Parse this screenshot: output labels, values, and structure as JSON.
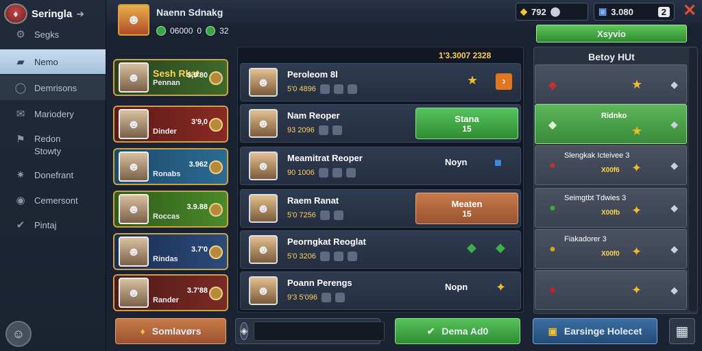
{
  "app": {
    "title": "Seringla"
  },
  "sidebar": {
    "items": [
      {
        "label": "Segks",
        "icon": "gear-icon"
      },
      {
        "label": "Nemo",
        "icon": "inbox-icon"
      },
      {
        "label": "Demrisons",
        "icon": "user-icon"
      },
      {
        "label": "Mariodery",
        "icon": "envelope-icon"
      },
      {
        "label": "Redon Stowty",
        "icon": "flag-icon"
      },
      {
        "label": "Donefrant",
        "icon": "settings-icon"
      },
      {
        "label": "Cemersont",
        "icon": "target-icon"
      },
      {
        "label": "Pintaj",
        "icon": "mail-icon"
      }
    ]
  },
  "profile": {
    "name": "Naenn Sdnakg",
    "coins": "06000",
    "zero": "0",
    "gems": "32"
  },
  "currency": {
    "gold": "792",
    "tickets": "3.080",
    "lives": "2"
  },
  "heroes": [
    {
      "title": "Sesh Rkat",
      "subtitle": "Pennan",
      "score": "3,9'80",
      "bg": "#3e6a2a"
    },
    {
      "title": "",
      "subtitle": "Dinder",
      "score": "3'9,0",
      "bg": "#8a2a24"
    },
    {
      "title": "",
      "subtitle": "Ronabs",
      "score": "3.962",
      "bg": "#2c6a92"
    },
    {
      "title": "",
      "subtitle": "Roccas",
      "score": "3.9.88",
      "bg": "#4a8a2a"
    },
    {
      "title": "",
      "subtitle": "Rindas",
      "score": "3.7'0",
      "bg": "#2c4a7a"
    },
    {
      "title": "",
      "subtitle": "Rander",
      "score": "3.7'88",
      "bg": "#7a2a24"
    }
  ],
  "main": {
    "header": "1'3.3007  2328",
    "rows": [
      {
        "name": "Peroleom 8l",
        "stat": "5'0 4896",
        "action": "",
        "sub": ""
      },
      {
        "name": "Nam Reoper",
        "stat": "93 2096",
        "action": "Stana",
        "sub": "15"
      },
      {
        "name": "Meamitrat Reoper",
        "stat": "90 1006",
        "action": "Noyn",
        "sub": ""
      },
      {
        "name": "Raem Ranat",
        "stat": "5'0 7256",
        "action": "Meaten",
        "sub": "15"
      },
      {
        "name": "Peorngkat Reoglat",
        "stat": "5'0 3206",
        "action": "",
        "sub": ""
      },
      {
        "name": "Poann Perengs",
        "stat": "9'3 5'096",
        "action": "Nopn",
        "sub": ""
      }
    ]
  },
  "right": {
    "top_label": "Xsyvio",
    "header": "Betoy HUt",
    "rows": [
      {
        "title": "",
        "value": "",
        "color": "#c43030"
      },
      {
        "title": "Ridnko",
        "value": "",
        "color": "#3ea83a"
      },
      {
        "title": "Slengkak Icteivee 3",
        "value": "X00f6",
        "color": "#c43030"
      },
      {
        "title": "Seimgtbt Tdwies 3",
        "value": "X00fb",
        "color": "#3ea83a"
      },
      {
        "title": "Fiakadorer 3",
        "value": "X00f0",
        "color": "#d2a41e"
      },
      {
        "title": "",
        "value": "",
        "color": "#d41c1c"
      }
    ]
  },
  "bottom": {
    "left_label": "Somlavørs",
    "search_placeholder": "",
    "green_label": "Dema Ad0",
    "blue_label": "Earsinge Holecet"
  }
}
